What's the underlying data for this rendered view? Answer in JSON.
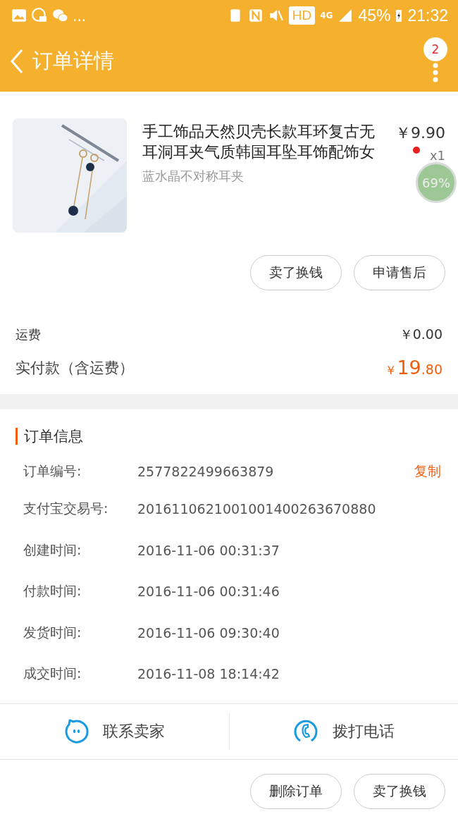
{
  "status_bar": {
    "more": "...",
    "hd": "HD",
    "network": "4G",
    "battery": "45%",
    "time": "21:32"
  },
  "header": {
    "title": "订单详情",
    "badge": "2"
  },
  "product": {
    "title": "手工饰品天然贝壳长款耳环复古无耳洞耳夹气质韩国耳坠耳饰配饰女",
    "spec": "蓝水晶不对称耳夹",
    "price": "￥9.90",
    "quantity": "x1"
  },
  "overlay": {
    "reading": "69%"
  },
  "product_actions": [
    "卖了换钱",
    "申请售后"
  ],
  "summary": {
    "shipping_label": "运费",
    "shipping_value": "￥0.00",
    "paid_label": "实付款（含运费）",
    "paid_currency": "￥",
    "paid_integer": "19",
    "paid_decimal": ".80"
  },
  "order_info": {
    "title": "订单信息",
    "rows": [
      {
        "label": "订单编号:",
        "value": "2577822499663879",
        "action": "复制"
      },
      {
        "label": "支付宝交易号:",
        "value": "2016110621001001400263670880"
      },
      {
        "label": "创建时间:",
        "value": "2016-11-06 00:31:37"
      },
      {
        "label": "付款时间:",
        "value": "2016-11-06 00:31:46"
      },
      {
        "label": "发货时间:",
        "value": "2016-11-06 09:30:40"
      },
      {
        "label": "成交时间:",
        "value": "2016-11-08 18:14:42"
      }
    ]
  },
  "contact": [
    {
      "kind": "chat",
      "label": "联系卖家"
    },
    {
      "kind": "phone",
      "label": "拨打电话"
    }
  ],
  "bottom_actions": [
    "删除订单",
    "卖了换钱"
  ]
}
